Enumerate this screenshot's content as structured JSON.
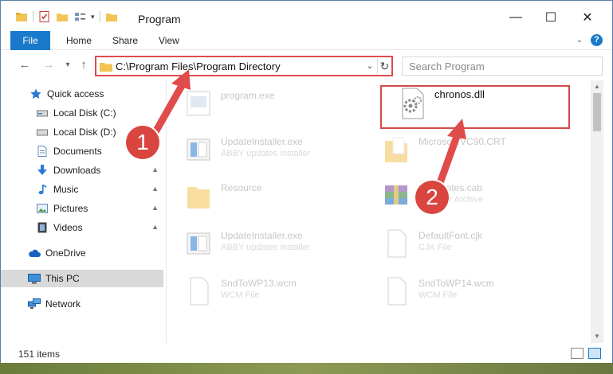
{
  "window": {
    "title": "Program"
  },
  "ribbon": {
    "tabs": [
      "File",
      "Home",
      "Share",
      "View"
    ],
    "help": "?"
  },
  "nav": {
    "address_path": "C:\\Program Files\\Program Directory",
    "search_placeholder": "Search Program"
  },
  "sidebar": {
    "items": [
      {
        "label": "Quick access"
      },
      {
        "label": "Local Disk (C:)"
      },
      {
        "label": "Local Disk (D:)"
      },
      {
        "label": "Documents"
      },
      {
        "label": "Downloads"
      },
      {
        "label": "Music"
      },
      {
        "label": "Pictures"
      },
      {
        "label": "Videos"
      },
      {
        "label": "OneDrive"
      },
      {
        "label": "This PC"
      },
      {
        "label": "Network"
      }
    ]
  },
  "files": [
    {
      "name": "program.exe",
      "sub": ""
    },
    {
      "name": "chronos.dll",
      "sub": ""
    },
    {
      "name": "UpdateInstaller.exe",
      "sub": "ABBY updates installer"
    },
    {
      "name": "Microsoft.VC90.CRT",
      "sub": ""
    },
    {
      "name": "Resource",
      "sub": ""
    },
    {
      "name": "certificates.cab",
      "sub": "WinRAR Archive"
    },
    {
      "name": "UpdateInstaller.exe",
      "sub": "ABBY updates installer"
    },
    {
      "name": "DefaultFont.cjk",
      "sub": "CJK File"
    },
    {
      "name": "SndToWP13.wcm",
      "sub": "WCM File"
    },
    {
      "name": "SndToWP14.wcm",
      "sub": "WCM File"
    }
  ],
  "status": {
    "item_count": "151 items"
  },
  "annotations": {
    "step1": "1",
    "step2": "2"
  },
  "colors": {
    "accent": "#1979ca",
    "annotation": "#d9453f",
    "selected": "#d9d9d9"
  }
}
